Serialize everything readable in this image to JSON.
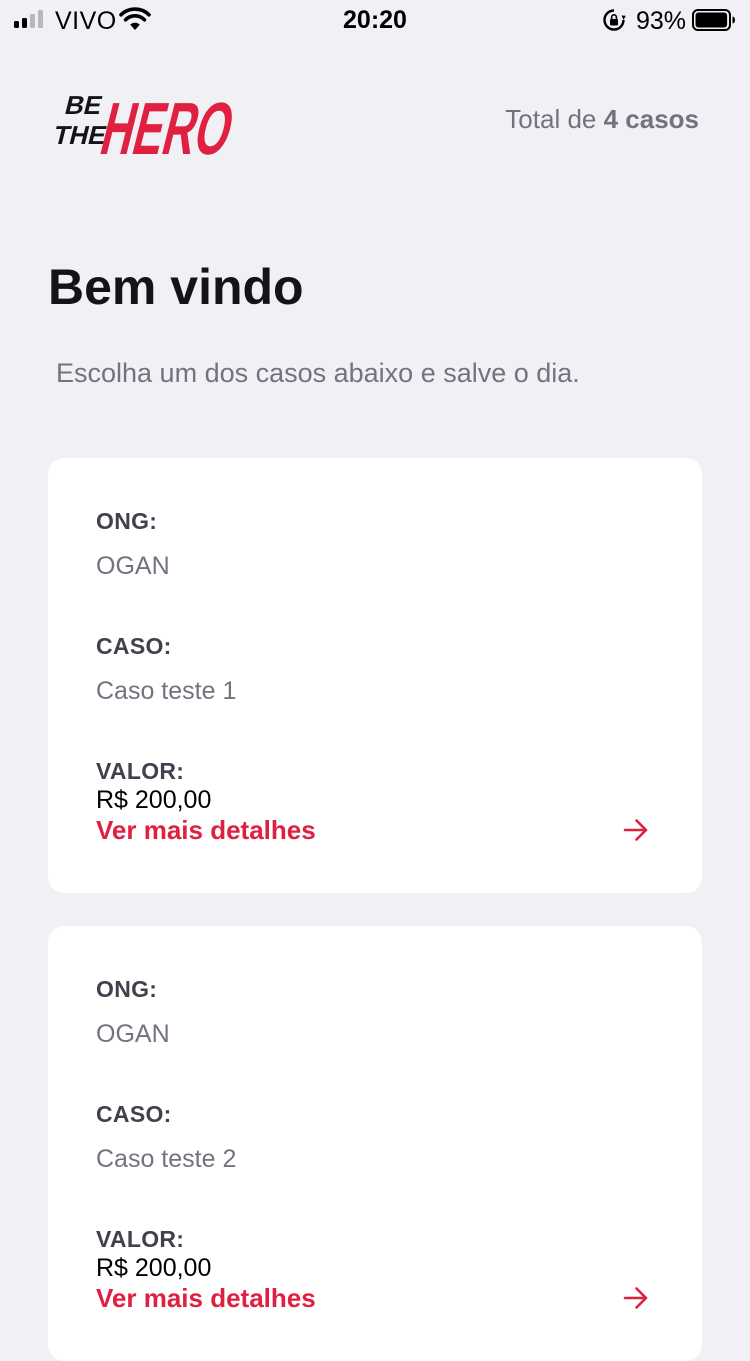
{
  "status_bar": {
    "carrier": "VIVO",
    "time": "20:20",
    "battery_percent": "93%",
    "battery_level": 0.93,
    "icons": [
      "signal-icon",
      "wifi-icon",
      "rotation-lock-icon",
      "battery-icon"
    ]
  },
  "header": {
    "logo": {
      "line1": "BE",
      "line2": "THE",
      "word": "HERO"
    },
    "total_prefix": "Total de ",
    "total_value": "4 casos"
  },
  "page": {
    "title": "Bem vindo",
    "subtitle": "Escolha um dos casos abaixo e salve o dia."
  },
  "cases": [
    {
      "ong_label": "ONG:",
      "ong_value": "OGAN",
      "caso_label": "CASO:",
      "caso_value": "Caso teste 1",
      "valor_label": "VALOR:",
      "valor_value": "R$ 200,00",
      "details_label": "Ver mais detalhes"
    },
    {
      "ong_label": "ONG:",
      "ong_value": "OGAN",
      "caso_label": "CASO:",
      "caso_value": "Caso teste 2",
      "valor_label": "VALOR:",
      "valor_value": "R$ 200,00",
      "details_label": "Ver mais detalhes"
    }
  ],
  "colors": {
    "background": "#f0f0f5",
    "brand_red": "#e02041",
    "card": "#ffffff",
    "heading": "#13131a",
    "muted": "#737380",
    "label": "#41414d"
  }
}
